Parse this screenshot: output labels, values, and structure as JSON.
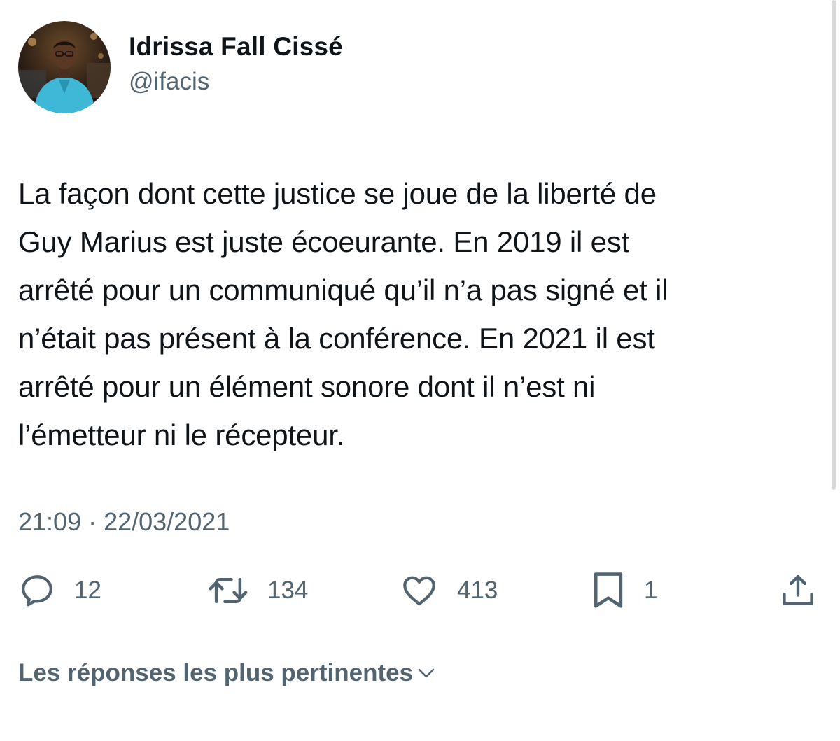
{
  "author": {
    "display_name": "Idrissa Fall Cissé",
    "handle": "@ifacis"
  },
  "tweet": {
    "text": "La façon dont cette justice se joue de la liberté de\nGuy Marius est juste écoeurante. En 2019 il est\narrêté pour un communiqué qu’il n’a pas signé et il\nn’était pas présent à la conférence. En 2021 il est\narrêté pour un élément sonore dont il n’est ni\nl’émetteur ni le récepteur.",
    "timestamp": "21:09 · 22/03/2021"
  },
  "actions": {
    "replies": "12",
    "retweets": "134",
    "likes": "413",
    "bookmarks": "1"
  },
  "replies_sort": {
    "label": "Les réponses les plus pertinentes"
  },
  "icons": {
    "reply": "reply-icon",
    "retweet": "retweet-icon",
    "like": "heart-icon",
    "bookmark": "bookmark-icon",
    "share": "share-icon",
    "sort": "chevron-down-icon"
  },
  "colors": {
    "text": "#0f1419",
    "secondary": "#536471",
    "avatar_shirt": "#3fb8d8"
  }
}
